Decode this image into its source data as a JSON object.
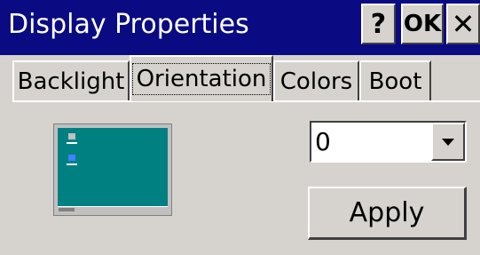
{
  "window": {
    "title": "Display Properties",
    "help_label": "?",
    "ok_label": "OK",
    "close_label": "✕",
    "colors": {
      "titlebar": "#0a0a82",
      "face": "#d6d3ce",
      "preview_desktop": "#008080"
    }
  },
  "tabs": [
    {
      "label": "Backlight",
      "selected": false
    },
    {
      "label": "Orientation",
      "selected": true
    },
    {
      "label": "Colors",
      "selected": false
    },
    {
      "label": "Boot",
      "selected": false
    }
  ],
  "orientation": {
    "selected_value": "0"
  },
  "apply_label": "Apply"
}
